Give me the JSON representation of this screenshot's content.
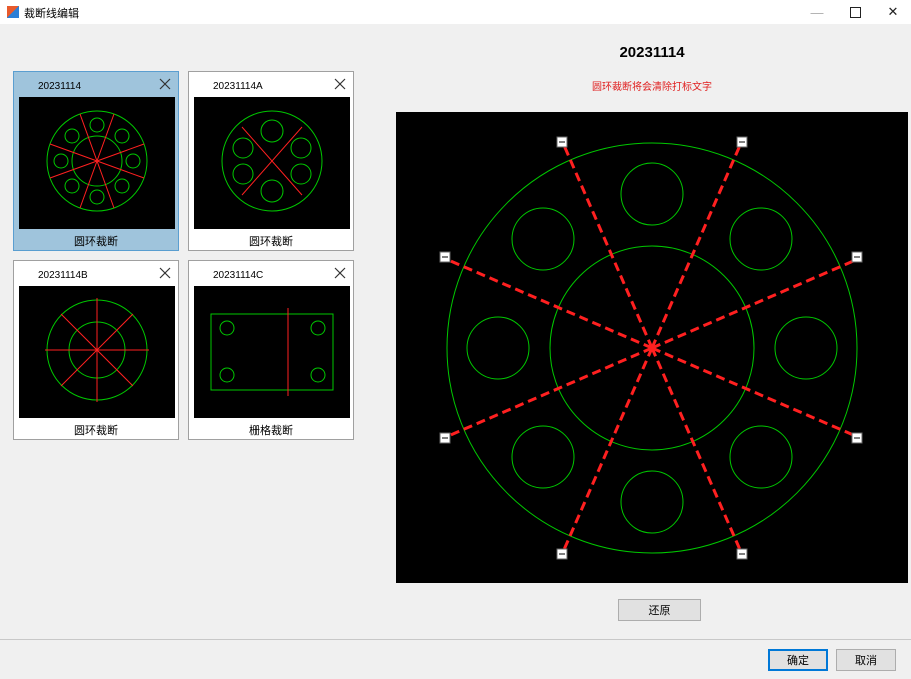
{
  "window": {
    "title": "裁断线编辑",
    "icon": "app-icon",
    "controls": [
      "minimize-icon",
      "maximize-icon",
      "close-icon"
    ]
  },
  "cards": [
    {
      "title": "20231114",
      "type_label": "圆环裁断",
      "selected": true,
      "thumb": "ring"
    },
    {
      "title": "20231114A",
      "type_label": "圆环裁断",
      "selected": false,
      "thumb": "ring6"
    },
    {
      "title": "20231114B",
      "type_label": "圆环裁断",
      "selected": false,
      "thumb": "ringplain"
    },
    {
      "title": "20231114C",
      "type_label": "栅格裁断",
      "selected": false,
      "thumb": "grid"
    }
  ],
  "preview": {
    "title": "20231114",
    "warning": "圆环裁断将会清除打标文字"
  },
  "buttons": {
    "restore": "还原",
    "ok": "确定",
    "cancel": "取消"
  },
  "colors": {
    "geometry": "#00c800",
    "cut_line": "#ff2020",
    "warning": "#e02020",
    "selected_card": "#9fc4dc"
  }
}
